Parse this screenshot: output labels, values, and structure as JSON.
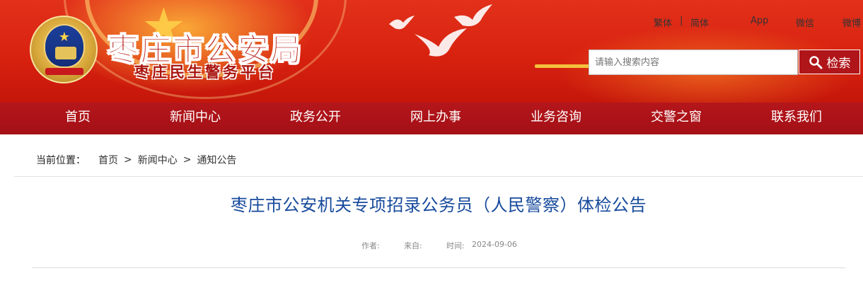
{
  "site": {
    "title": "枣庄市公安局",
    "subtitle": "枣庄民生警务平台"
  },
  "top_links": {
    "traditional": "繁体",
    "separator": "|",
    "simplified": "简体",
    "app": "App",
    "wechat": "微信",
    "weibo": "微博"
  },
  "search": {
    "placeholder": "请输入搜索内容",
    "button_label": "检索"
  },
  "nav": {
    "items": [
      {
        "label": "首页"
      },
      {
        "label": "新闻中心"
      },
      {
        "label": "政务公开"
      },
      {
        "label": "网上办事"
      },
      {
        "label": "业务咨询"
      },
      {
        "label": "交警之窗"
      },
      {
        "label": "联系我们"
      }
    ]
  },
  "breadcrumb": {
    "label": "当前位置：",
    "items": [
      "首页",
      "新闻中心",
      "通知公告"
    ],
    "separator": ">"
  },
  "article": {
    "title": "枣庄市公安机关专项招录公务员（人民警察）体检公告",
    "author_label": "作者:",
    "source_label": "来自:",
    "time_label": "时间:",
    "time_value": "2024-09-06"
  },
  "colors": {
    "brand_red": "#b4161b",
    "title_blue": "#174a9c",
    "gold": "#f6c83c"
  }
}
